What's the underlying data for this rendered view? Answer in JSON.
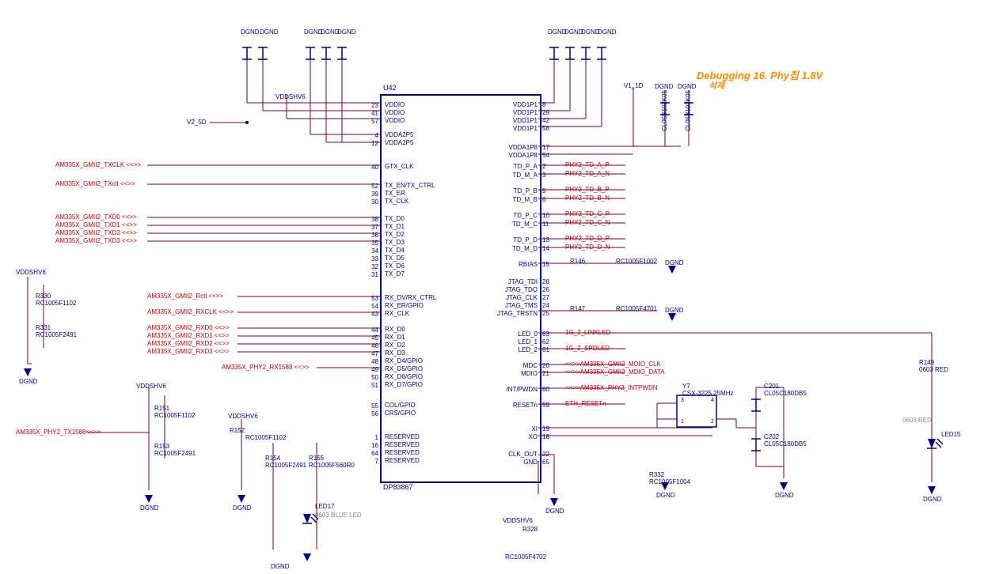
{
  "annotation": {
    "debug_note": "Debugging 16. Phy칩 1.8V",
    "debug_note2": "삭제"
  },
  "chip": {
    "refdes": "U42",
    "footer": "DP83867"
  },
  "power_rails": {
    "vddshv6_left": "VDDSHV6",
    "vddshv6_top": "VDDSHV6",
    "vddshv6_mid1": "VDDSHV6",
    "vddshv6_mid2": "VDDSHV6",
    "vddshv6_bot": "VDDSHV6",
    "v2_5d": "V2_5D",
    "v1_1d": "V1_1D"
  },
  "gnd_labels": {
    "g1": "DGND",
    "g2": "DGND",
    "g3": "DGND",
    "g4": "DGND",
    "g5": "DGND",
    "g6": "DGND",
    "g7": "DGND",
    "g8": "DGND",
    "g9": "DGND",
    "g10": "DGND",
    "g11": "DGND",
    "g12": "DGND",
    "g13": "DGND",
    "g14": "DGND",
    "g15": "DGND",
    "g16": "DGND",
    "g17": "DGND"
  },
  "left_pins": [
    {
      "num": "23",
      "name": "VDDIO"
    },
    {
      "num": "41",
      "name": "VDDIO"
    },
    {
      "num": "57",
      "name": "VDDIO"
    },
    {
      "num": "4",
      "name": "VDDA2P5"
    },
    {
      "num": "12",
      "name": "VDDA2P5"
    },
    {
      "num": "40",
      "name": "GTX_CLK"
    },
    {
      "num": "52",
      "name": "TX_EN/TX_CTRL"
    },
    {
      "num": "39",
      "name": "TX_ER"
    },
    {
      "num": "30",
      "name": "TX_CLK"
    },
    {
      "num": "38",
      "name": "TX_D0"
    },
    {
      "num": "37",
      "name": "TX_D1"
    },
    {
      "num": "36",
      "name": "TX_D2"
    },
    {
      "num": "35",
      "name": "TX_D3"
    },
    {
      "num": "34",
      "name": "TX_D4"
    },
    {
      "num": "33",
      "name": "TX_D5"
    },
    {
      "num": "32",
      "name": "TX_D6"
    },
    {
      "num": "31",
      "name": "TX_D7"
    },
    {
      "num": "53",
      "name": "RX_DV/RX_CTRL"
    },
    {
      "num": "54",
      "name": "RX_ER/GPIO"
    },
    {
      "num": "43",
      "name": "RX_CLK"
    },
    {
      "num": "44",
      "name": "RX_D0"
    },
    {
      "num": "45",
      "name": "RX_D1"
    },
    {
      "num": "46",
      "name": "RX_D2"
    },
    {
      "num": "47",
      "name": "RX_D3"
    },
    {
      "num": "48",
      "name": "RX_D4/GPIO"
    },
    {
      "num": "49",
      "name": "RX_D5/GPIO"
    },
    {
      "num": "50",
      "name": "RX_D6/GPIO"
    },
    {
      "num": "51",
      "name": "RX_D7/GPIO"
    },
    {
      "num": "55",
      "name": "COL/GPIO"
    },
    {
      "num": "56",
      "name": "CRS/GPIO"
    },
    {
      "num": "1",
      "name": "RESERVED"
    },
    {
      "num": "16",
      "name": "RESERVED"
    },
    {
      "num": "64",
      "name": "RESERVED"
    },
    {
      "num": "7",
      "name": "RESERVED"
    }
  ],
  "right_pins": [
    {
      "num": "8",
      "name": "VDD1P1"
    },
    {
      "num": "29",
      "name": "VDD1P1"
    },
    {
      "num": "42",
      "name": "VDD1P1"
    },
    {
      "num": "58",
      "name": "VDD1P1"
    },
    {
      "num": "17",
      "name": "VDDA1P8"
    },
    {
      "num": "54",
      "name": "VDDA1P8"
    },
    {
      "num": "2",
      "name": "TD_P_A"
    },
    {
      "num": "3",
      "name": "TD_M_A"
    },
    {
      "num": "5",
      "name": "TD_P_B"
    },
    {
      "num": "6",
      "name": "TD_M_B"
    },
    {
      "num": "10",
      "name": "TD_P_C"
    },
    {
      "num": "11",
      "name": "TD_M_C"
    },
    {
      "num": "13",
      "name": "TD_P_D"
    },
    {
      "num": "14",
      "name": "TD_M_D"
    },
    {
      "num": "15",
      "name": "RBIAS"
    },
    {
      "num": "28",
      "name": "JTAG_TDI"
    },
    {
      "num": "26",
      "name": "JTAG_TDO"
    },
    {
      "num": "27",
      "name": "JTAG_CLK"
    },
    {
      "num": "24",
      "name": "JTAG_TMS"
    },
    {
      "num": "25",
      "name": "JTAG_TRSTN"
    },
    {
      "num": "63",
      "name": "LED_0"
    },
    {
      "num": "62",
      "name": "LED_1"
    },
    {
      "num": "61",
      "name": "LED_2"
    },
    {
      "num": "20",
      "name": "MDC"
    },
    {
      "num": "21",
      "name": "MDIO"
    },
    {
      "num": "60",
      "name": "INT/PWDN"
    },
    {
      "num": "59",
      "name": "RESETn"
    },
    {
      "num": "19",
      "name": "XI"
    },
    {
      "num": "18",
      "name": "XO"
    },
    {
      "num": "22",
      "name": "CLK_OUT"
    },
    {
      "num": "65",
      "name": "GND"
    }
  ],
  "left_ports": {
    "p1": "AM335X_GMII2_TXCLK",
    "p2": "AM335X_GMII2_TXctl",
    "p3": "AM335X_GMII2_TXD0",
    "p4": "AM335X_GMII2_TXD1",
    "p5": "AM335X_GMII2_TXD2",
    "p6": "AM335X_GMII2_TXD3",
    "p7": "AM335X_GMII2_Rctl",
    "p8": "AM335X_GMII2_RXCLK",
    "p9": "AM335X_GMII2_RXD0",
    "p10": "AM335X_GMII2_RXD1",
    "p11": "AM335X_GMII2_RXD2",
    "p12": "AM335X_GMII2_RXD3",
    "p13": "AM335X_PHY2_RX1588",
    "p14": "AM335X_PHY2_TX1588"
  },
  "right_nets": {
    "n1": "PHY2_TD_A_P",
    "n2": "PHY2_TD_A_N",
    "n3": "PHY2_TD_B_P",
    "n4": "PHY2_TD_B_N",
    "n5": "PHY2_TD_C_P",
    "n6": "PHY2_TD_C_N",
    "n7": "PHY2_TD_D_P",
    "n8": "PHY2_TD_D_N",
    "n9": "1G_2_LINKLED",
    "n10": "1G_2_SPDLED",
    "n11": "AM335X_GMII2_MDIO_CLK",
    "n12": "AM335X_GMII2_MDIO_DATA",
    "n13": "AM335X_PHY2_INTPWDN",
    "n14": "ETH_RESETn"
  },
  "components": {
    "r330": {
      "ref": "R330",
      "val": "RC1005F1102"
    },
    "r331": {
      "ref": "R331",
      "val": "RC1005F2491"
    },
    "r151": {
      "ref": "R151",
      "val": "RC1005F1102"
    },
    "r153": {
      "ref": "R153",
      "val": "RC1005F2491"
    },
    "r152": {
      "ref": "R152",
      "val": "RC1005F1102"
    },
    "r154": {
      "ref": "R154",
      "val": "RC1005F2491"
    },
    "r155": {
      "ref": "R155",
      "val": "RC1005F560R0"
    },
    "r146": {
      "ref": "R146",
      "val": "RC1005F1002"
    },
    "r147": {
      "ref": "R147",
      "val": "RC1005F4701"
    },
    "r332": {
      "ref": "R332",
      "val": "RC1005F1004"
    },
    "r328": {
      "ref": "R328",
      "val": "RC1005F4702"
    },
    "r149": {
      "ref": "R149",
      "val": "0603 RED"
    },
    "c201": {
      "ref": "C201",
      "val": "CL05C180DB5"
    },
    "c202": {
      "ref": "C202",
      "val": "CL05C180DB5"
    },
    "cla": {
      "val": "CL05B102K05"
    },
    "clb": {
      "val": "CL05B102K05"
    },
    "y7": {
      "ref": "Y7",
      "val": "CSX-3225 25MHz"
    },
    "y7_pins": {
      "p1": "1",
      "p2": "2",
      "p3": "3",
      "p4": "4"
    },
    "led17": {
      "ref": "LED17",
      "val": "0603 BLUE LED"
    },
    "led15": {
      "ref": "LED15",
      "val": "0603 RED"
    }
  }
}
